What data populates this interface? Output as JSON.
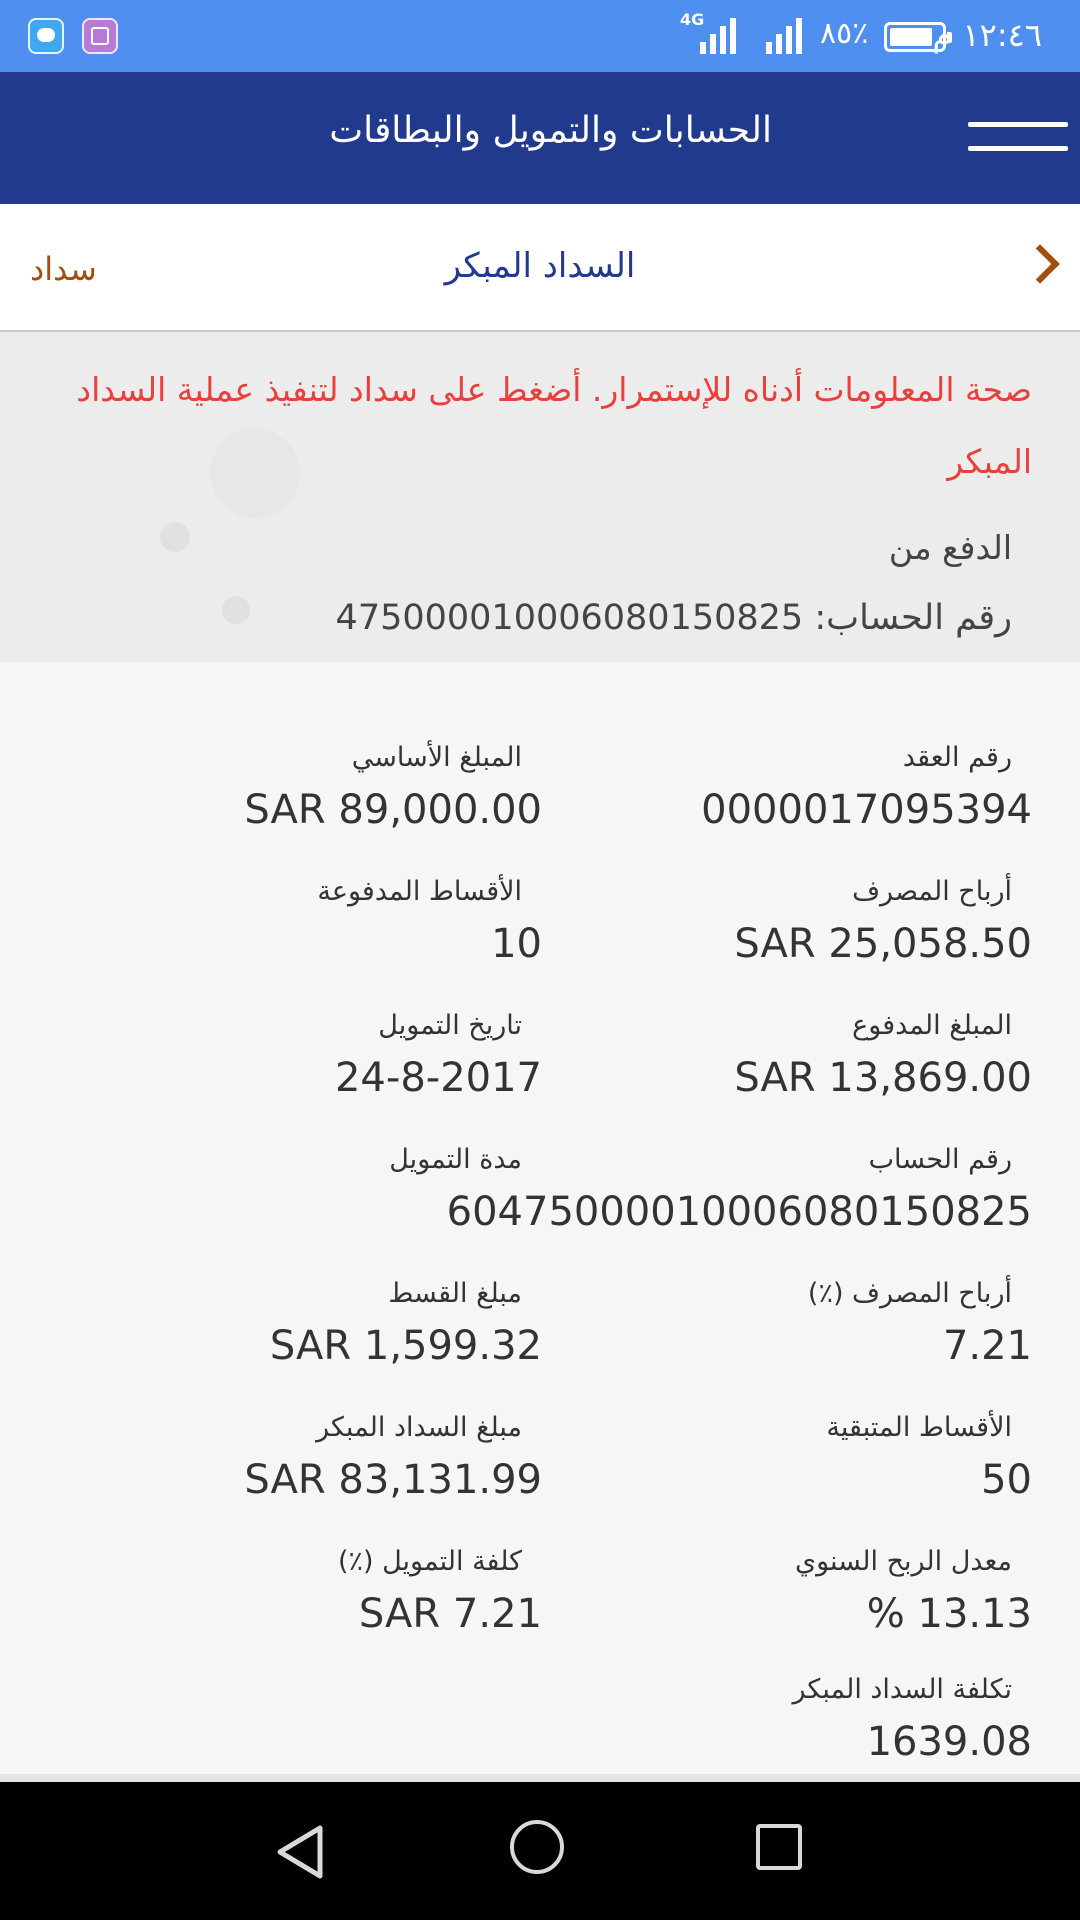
{
  "status_bar": {
    "time": "١٢:٤٦ م",
    "battery_pct": "٨٥٪",
    "network": "4G",
    "apps": [
      "messages-icon",
      "gallery-icon"
    ]
  },
  "header": {
    "title": "الحسابات والتمويل والبطاقات",
    "menu_icon": "hamburger-menu-icon"
  },
  "subheader": {
    "title": "السداد المبكر",
    "action_label": "سداد",
    "back_icon": "chevron-right-icon"
  },
  "notice": {
    "message": "صحة المعلومات أدناه للإستمرار. أضغط على سداد لتنفيذ عملية السداد المبكر",
    "pay_from_label": "الدفع من",
    "account_label": "رقم الحساب:",
    "account_number": "4750000100060801508​25"
  },
  "details": {
    "contract_number": {
      "label": "رقم العقد",
      "value": "0000017095394"
    },
    "principal_amount": {
      "label": "المبلغ الأساسي",
      "value": "SAR 89,000.00"
    },
    "bank_profit": {
      "label": "أرباح المصرف",
      "value": "SAR 25,058.50"
    },
    "paid_installments": {
      "label": "الأقساط المدفوعة",
      "value": "10"
    },
    "paid_amount": {
      "label": "المبلغ المدفوع",
      "value": "SAR 13,869.00"
    },
    "finance_date": {
      "label": "تاريخ التمويل",
      "value": "24-8-2017"
    },
    "account_number": {
      "label": "رقم الحساب",
      "value": "604750000100060801508​25"
    },
    "finance_term": {
      "label": "مدة التمويل",
      "value": ""
    },
    "bank_profit_pct": {
      "label": "أرباح المصرف (٪)",
      "value": "7.21"
    },
    "installment_amount": {
      "label": "مبلغ القسط",
      "value": "SAR 1,599.32"
    },
    "remaining_installments": {
      "label": "الأقساط المتبقية",
      "value": "50"
    },
    "early_payment_amount": {
      "label": "مبلغ السداد المبكر",
      "value": "SAR 83,131.99"
    },
    "annual_profit_rate": {
      "label": "معدل الربح السنوي",
      "value": "% 13.13"
    },
    "finance_cost_pct": {
      "label": "كلفة التمويل (٪)",
      "value": "SAR 7.21"
    },
    "early_payment_cost": {
      "label": "تكلفة السداد المبكر",
      "value": "1639.08"
    }
  },
  "nav": {
    "back_icon": "nav-back-icon",
    "home_icon": "nav-home-icon",
    "recent_icon": "nav-recent-apps-icon"
  }
}
